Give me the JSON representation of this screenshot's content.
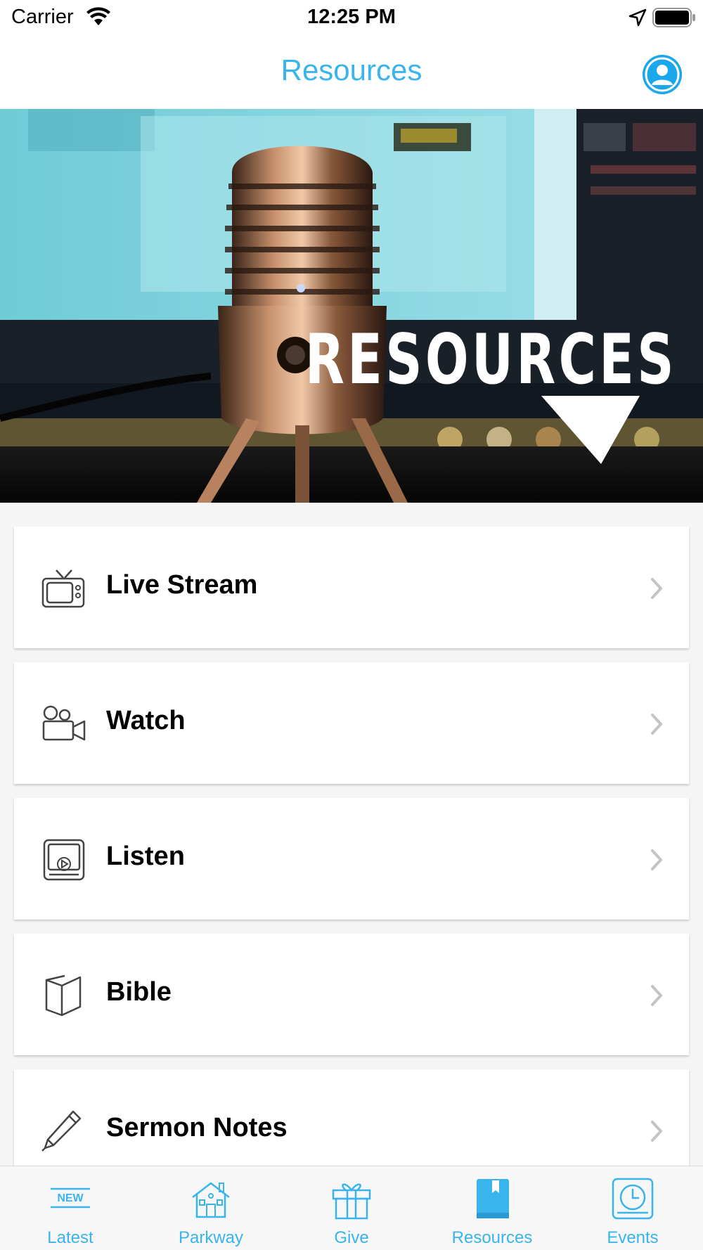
{
  "status_bar": {
    "carrier": "Carrier",
    "time": "12:25 PM"
  },
  "nav": {
    "title": "Resources",
    "accent": "#39b4ec"
  },
  "hero": {
    "overlay_text": "RESOURCES",
    "image": "microphone-photo"
  },
  "list": {
    "items": [
      {
        "label": "Live Stream",
        "icon": "tv-icon"
      },
      {
        "label": "Watch",
        "icon": "video-camera-icon"
      },
      {
        "label": "Listen",
        "icon": "media-player-icon"
      },
      {
        "label": "Bible",
        "icon": "book-icon"
      },
      {
        "label": "Sermon Notes",
        "icon": "pencil-icon"
      }
    ]
  },
  "tab_bar": {
    "tabs": [
      {
        "label": "Latest",
        "icon": "new-badge-icon",
        "badge": "NEW"
      },
      {
        "label": "Parkway",
        "icon": "house-icon"
      },
      {
        "label": "Give",
        "icon": "gift-icon"
      },
      {
        "label": "Resources",
        "icon": "book-icon",
        "selected": true
      },
      {
        "label": "Events",
        "icon": "clock-icon"
      }
    ]
  }
}
